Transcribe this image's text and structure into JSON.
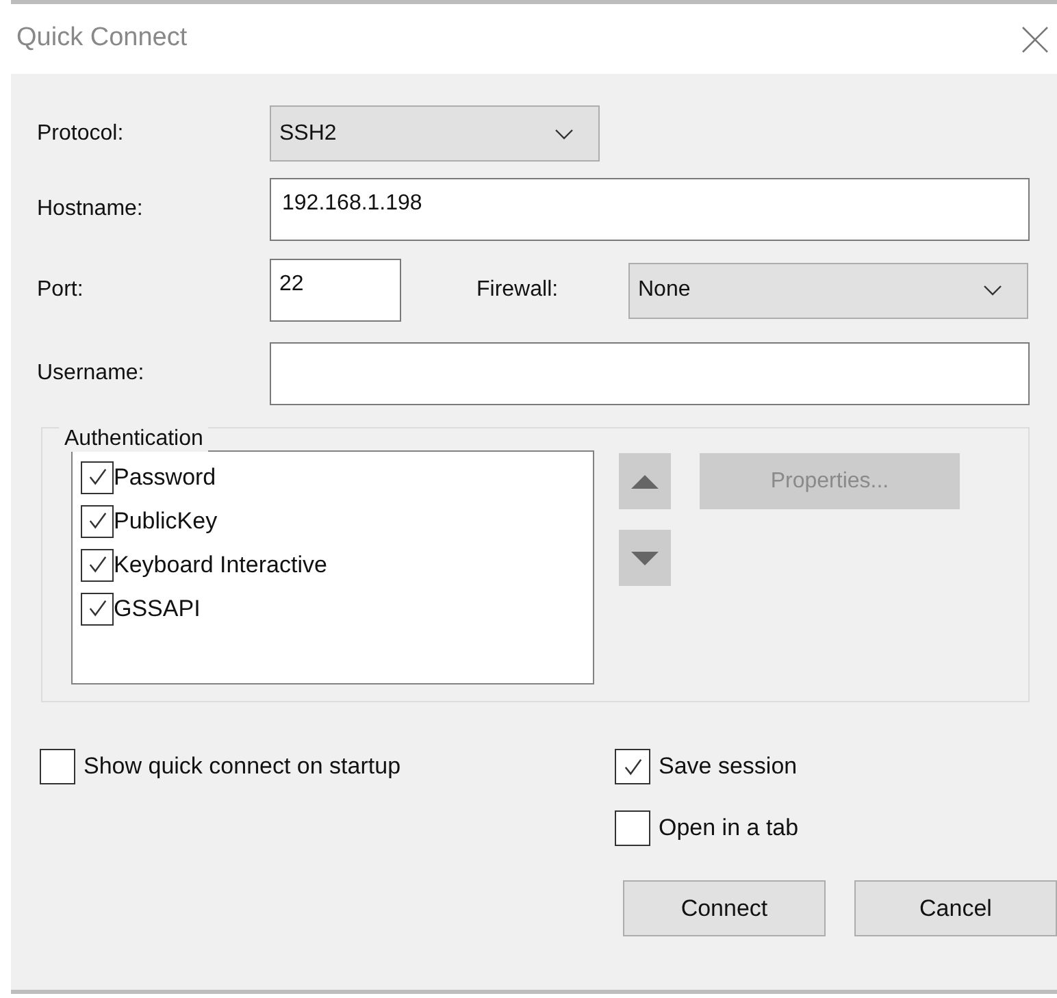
{
  "window": {
    "title": "Quick Connect"
  },
  "protocol": {
    "label": "Protocol:",
    "value": "SSH2"
  },
  "hostname": {
    "label": "Hostname:",
    "value": "192.168.1.198"
  },
  "port": {
    "label": "Port:",
    "value": "22"
  },
  "firewall": {
    "label": "Firewall:",
    "value": "None"
  },
  "username": {
    "label": "Username:"
  },
  "authentication": {
    "title": "Authentication",
    "methods": [
      {
        "label": "Password",
        "checked": true
      },
      {
        "label": "PublicKey",
        "checked": true
      },
      {
        "label": "Keyboard Interactive",
        "checked": true
      },
      {
        "label": "GSSAPI",
        "checked": true
      }
    ],
    "properties_button": {
      "label": "Properties...",
      "disabled": true
    }
  },
  "options": [
    {
      "label": "Show quick connect on startup",
      "checked": false
    },
    {
      "label": "Save session",
      "checked": true
    },
    {
      "label": "Open in a tab",
      "checked": false
    }
  ],
  "buttons": [
    {
      "label": "Connect"
    },
    {
      "label": "Cancel"
    }
  ]
}
